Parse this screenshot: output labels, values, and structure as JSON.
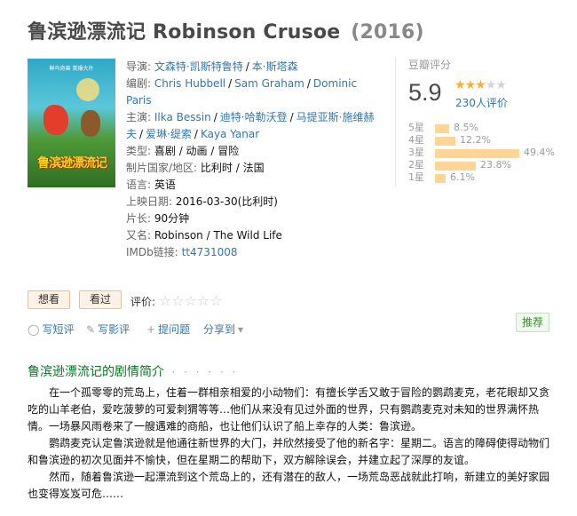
{
  "header": {
    "title": "鲁滨逊漂流记 Robinson Crusoe",
    "year": "(2016)"
  },
  "poster": {
    "tagline": "鲜鸟奇兽 笑爆大片",
    "title_art": "鲁滨逊漂流记"
  },
  "info": {
    "director_label": "导演:",
    "directors": [
      "文森特·凯斯特鲁特",
      "本·斯塔森"
    ],
    "writer_label": "编剧:",
    "writers": [
      "Chris Hubbell",
      "Sam Graham",
      "Dominic Paris"
    ],
    "cast_label": "主演:",
    "cast": [
      "Ilka Bessin",
      "迪特·哈勒沃登",
      "马提亚斯·施维赫夫",
      "爱琳·缇索",
      "Kaya Yanar"
    ],
    "genre_label": "类型:",
    "genre": "喜剧 / 动画 / 冒险",
    "country_label": "制片国家/地区:",
    "country": "比利时 / 法国",
    "language_label": "语言:",
    "language": "英语",
    "release_label": "上映日期:",
    "release": "2016-03-30(比利时)",
    "runtime_label": "片长:",
    "runtime": "90分钟",
    "aka_label": "又名:",
    "aka": "Robinson / The Wild Life",
    "imdb_label": "IMDb链接:",
    "imdb": "tt4731008"
  },
  "rating": {
    "label": "豆瓣评分",
    "score": "5.9",
    "stars_filled": 3,
    "stars_total": 5,
    "votes": "230人评价",
    "distribution": [
      {
        "label": "5星",
        "pct_text": "8.5%",
        "pct": 8.5
      },
      {
        "label": "4星",
        "pct_text": "12.2%",
        "pct": 12.2
      },
      {
        "label": "3星",
        "pct_text": "49.4%",
        "pct": 49.4
      },
      {
        "label": "2星",
        "pct_text": "23.8%",
        "pct": 23.8
      },
      {
        "label": "1星",
        "pct_text": "6.1%",
        "pct": 6.1
      }
    ],
    "colors": {
      "star_on": "#ffac2d",
      "bar": "#ffd596"
    }
  },
  "actions": {
    "want": "想看",
    "watched": "看过",
    "rate_label": "评价:",
    "rate_stars": "☆☆☆☆☆"
  },
  "tools": {
    "write_review": "写短评",
    "write_film_review": "写影评",
    "ask": "提问题",
    "share": "分享到",
    "recommend": "推荐"
  },
  "summary": {
    "heading": "鲁滨逊漂流记的剧情简介",
    "heading_dots": "· · · · · ·",
    "paragraphs": [
      "在一个孤零零的荒岛上，住着一群相亲相爱的小动物们：有擅长学舌又敢于冒险的鹦鹉麦克，老花眼却又贪吃的山羊老伯，爱吃菠萝的可爱刺猬等等…他们从来没有见过外面的世界，只有鹦鹉麦克对未知的世界满怀热情。一场暴风雨卷来了一艘遇难的商船，也让他们认识了船上幸存的人类：鲁滨逊。",
      "鹦鹉麦克认定鲁滨逊就是他通往新世界的大门，并欣然接受了他的新名字：星期二。语言的障碍使得动物们和鲁滨逊的初次见面并不愉快，但在星期二的帮助下，双方解除误会，并建立起了深厚的友谊。",
      "然而，随着鲁滨逊一起漂流到这个荒岛上的，还有潜在的敌人，一场荒岛恶战就此打响，新建立的美好家园也变得岌岌可危……"
    ]
  }
}
